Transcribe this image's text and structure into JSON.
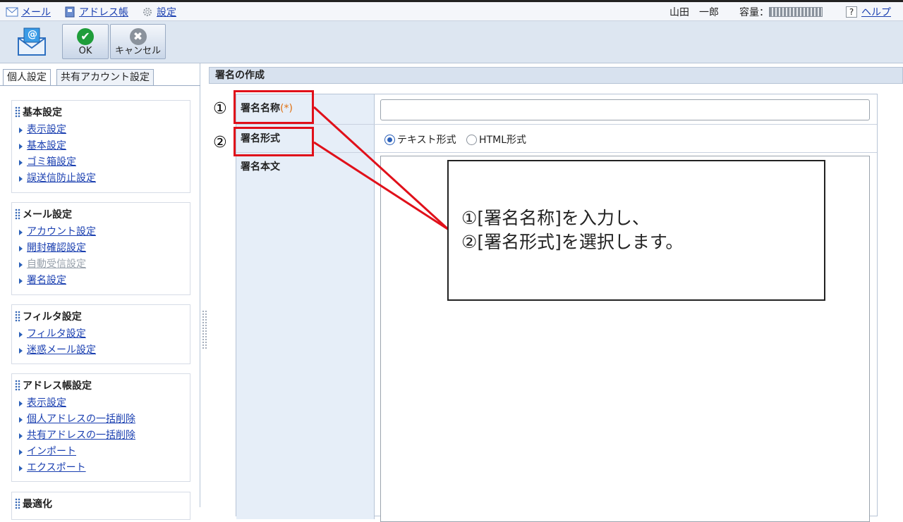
{
  "topbar": {
    "nav": [
      {
        "icon": "mail-icon",
        "label": "メール"
      },
      {
        "icon": "address-book-icon",
        "label": "アドレス帳"
      },
      {
        "icon": "gear-icon",
        "label": "設定"
      }
    ],
    "user": "山田　一郎",
    "quota_label": "容量：",
    "help_label": "ヘルプ",
    "help_icon_text": "?"
  },
  "toolbar": {
    "ok_label": "OK",
    "cancel_label": "キャンセル",
    "ok_glyph": "✔",
    "cancel_glyph": "✖",
    "mail_glyph": "@"
  },
  "sidebar": {
    "tabs": [
      "個人設定",
      "共有アカウント設定"
    ],
    "sections": [
      {
        "title": "基本設定",
        "items": [
          {
            "label": "表示設定",
            "disabled": false
          },
          {
            "label": "基本設定",
            "disabled": false
          },
          {
            "label": "ゴミ箱設定",
            "disabled": false
          },
          {
            "label": "誤送信防止設定",
            "disabled": false
          }
        ]
      },
      {
        "title": "メール設定",
        "items": [
          {
            "label": "アカウント設定",
            "disabled": false
          },
          {
            "label": "開封確認設定",
            "disabled": false
          },
          {
            "label": "自動受信設定",
            "disabled": true
          },
          {
            "label": "署名設定",
            "disabled": false
          }
        ]
      },
      {
        "title": "フィルタ設定",
        "items": [
          {
            "label": "フィルタ設定",
            "disabled": false
          },
          {
            "label": "迷惑メール設定",
            "disabled": false
          }
        ]
      },
      {
        "title": "アドレス帳設定",
        "items": [
          {
            "label": "表示設定",
            "disabled": false
          },
          {
            "label": "個人アドレスの一括削除",
            "disabled": false
          },
          {
            "label": "共有アドレスの一括削除",
            "disabled": false
          },
          {
            "label": "インポート",
            "disabled": false
          },
          {
            "label": "エクスポート",
            "disabled": false
          }
        ]
      },
      {
        "title": "最適化",
        "items": []
      }
    ]
  },
  "main": {
    "header": "署名の作成",
    "fields": {
      "name_label": "署名名称",
      "required_mark": "(*)",
      "name_value": "",
      "format_label": "署名形式",
      "format_options": [
        "テキスト形式",
        "HTML形式"
      ],
      "format_selected": "テキスト形式",
      "body_label": "署名本文",
      "body_value": ""
    }
  },
  "annotations": {
    "num1": "①",
    "num2": "②",
    "callout_line1": "①[署名名称]を入力し、",
    "callout_line2": "②[署名形式]を選択します。",
    "accent_color": "#e0101a"
  }
}
